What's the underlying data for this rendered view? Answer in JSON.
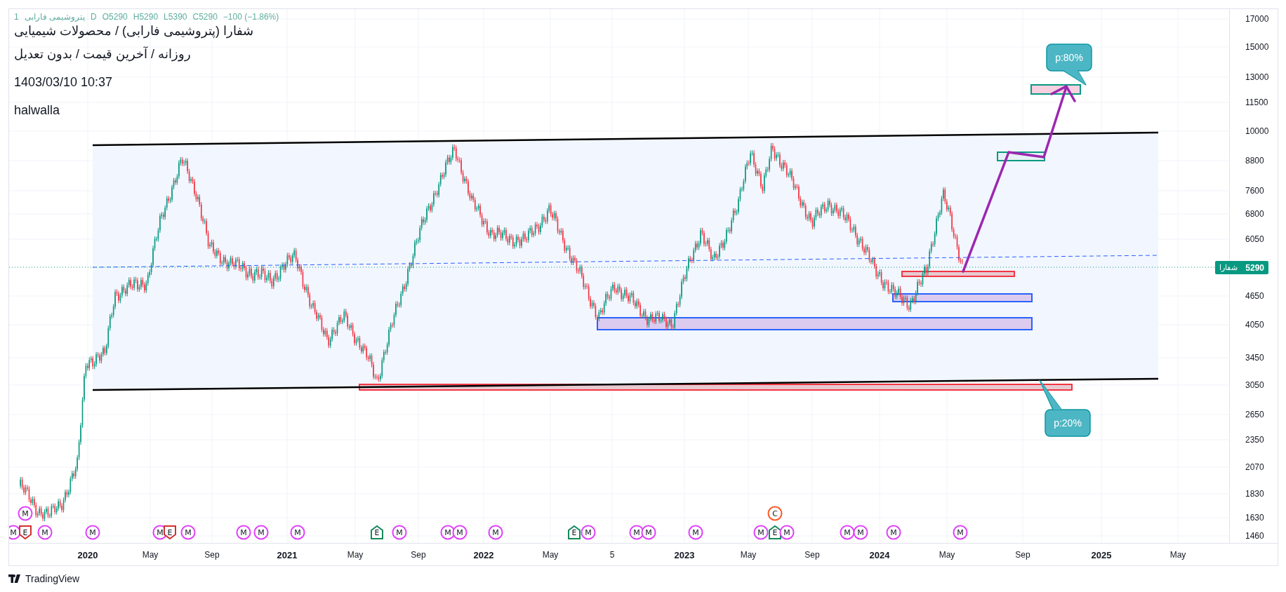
{
  "legend": {
    "items": [
      "1",
      "پتروشیمی فارابی",
      "D",
      "O5290",
      "H5290",
      "L5390",
      "C5290",
      "−100 (−1.86%)"
    ]
  },
  "title_lines": [
    "شفارا (پتروشیمی فارابی) / محصولات شیمیایی",
    "روزانه / آخرین قیمت / بدون تعدیل",
    "1403/03/10 10:37",
    "halwalla"
  ],
  "callouts": [
    {
      "text": "p:80%"
    },
    {
      "text": "p:20%"
    }
  ],
  "events": [
    {
      "label": "M",
      "kind": "circle",
      "color": "#e040fb"
    },
    {
      "label": "C",
      "kind": "circle",
      "color": "#ff5722"
    },
    {
      "label": "M",
      "kind": "circle",
      "color": "#e040fb"
    },
    {
      "label": "E",
      "kind": "pennant-down",
      "color": "#d32f2f"
    },
    {
      "label": "M",
      "kind": "circle",
      "color": "#e040fb"
    },
    {
      "label": "M",
      "kind": "circle",
      "color": "#e040fb"
    },
    {
      "label": "M",
      "kind": "circle",
      "color": "#e040fb"
    },
    {
      "label": "E",
      "kind": "pennant-down",
      "color": "#d32f2f"
    },
    {
      "label": "M",
      "kind": "circle",
      "color": "#e040fb"
    },
    {
      "label": "M",
      "kind": "circle",
      "color": "#e040fb"
    },
    {
      "label": "M",
      "kind": "circle",
      "color": "#e040fb"
    },
    {
      "label": "M",
      "kind": "circle",
      "color": "#e040fb"
    },
    {
      "label": "E",
      "kind": "pennant-up",
      "color": "#138a5a"
    },
    {
      "label": "M",
      "kind": "circle",
      "color": "#e040fb"
    },
    {
      "label": "M",
      "kind": "circle",
      "color": "#e040fb"
    },
    {
      "label": "M",
      "kind": "circle",
      "color": "#e040fb"
    },
    {
      "label": "M",
      "kind": "circle",
      "color": "#e040fb"
    },
    {
      "label": "E",
      "kind": "pennant-up",
      "color": "#138a5a"
    },
    {
      "label": "M",
      "kind": "circle",
      "color": "#e040fb"
    },
    {
      "label": "M",
      "kind": "circle",
      "color": "#e040fb"
    },
    {
      "label": "M",
      "kind": "circle",
      "color": "#e040fb"
    },
    {
      "label": "M",
      "kind": "circle",
      "color": "#e040fb"
    },
    {
      "label": "M",
      "kind": "circle",
      "color": "#e040fb"
    },
    {
      "label": "E",
      "kind": "pennant-up",
      "color": "#138a5a"
    },
    {
      "label": "M",
      "kind": "circle",
      "color": "#e040fb"
    },
    {
      "label": "M",
      "kind": "circle",
      "color": "#e040fb"
    },
    {
      "label": "M",
      "kind": "circle",
      "color": "#e040fb"
    },
    {
      "label": "M",
      "kind": "circle",
      "color": "#e040fb"
    },
    {
      "label": "M",
      "kind": "circle",
      "color": "#e040fb"
    }
  ],
  "price_axis": {
    "ticks": [
      "17000",
      "15000",
      "13000",
      "11500",
      "10000",
      "8800",
      "7600",
      "6800",
      "6050",
      "4650",
      "4050",
      "3450",
      "3050",
      "2650",
      "2350",
      "2070",
      "1830",
      "1630",
      "1460"
    ],
    "last_price": {
      "symbol": "شفارا",
      "value": "5290"
    }
  },
  "time_axis": {
    "labels": [
      {
        "text": "2020",
        "major": true
      },
      {
        "text": "May",
        "major": false
      },
      {
        "text": "Sep",
        "major": false
      },
      {
        "text": "2021",
        "major": true
      },
      {
        "text": "May",
        "major": false
      },
      {
        "text": "Sep",
        "major": false
      },
      {
        "text": "2022",
        "major": true
      },
      {
        "text": "May",
        "major": false
      },
      {
        "text": "5",
        "major": false
      },
      {
        "text": "2023",
        "major": true
      },
      {
        "text": "May",
        "major": false
      },
      {
        "text": "Sep",
        "major": false
      },
      {
        "text": "2024",
        "major": true
      },
      {
        "text": "May",
        "major": false
      },
      {
        "text": "Sep",
        "major": false
      },
      {
        "text": "2025",
        "major": true
      },
      {
        "text": "May",
        "major": false
      }
    ]
  },
  "footer": {
    "brand": "TradingView"
  }
}
